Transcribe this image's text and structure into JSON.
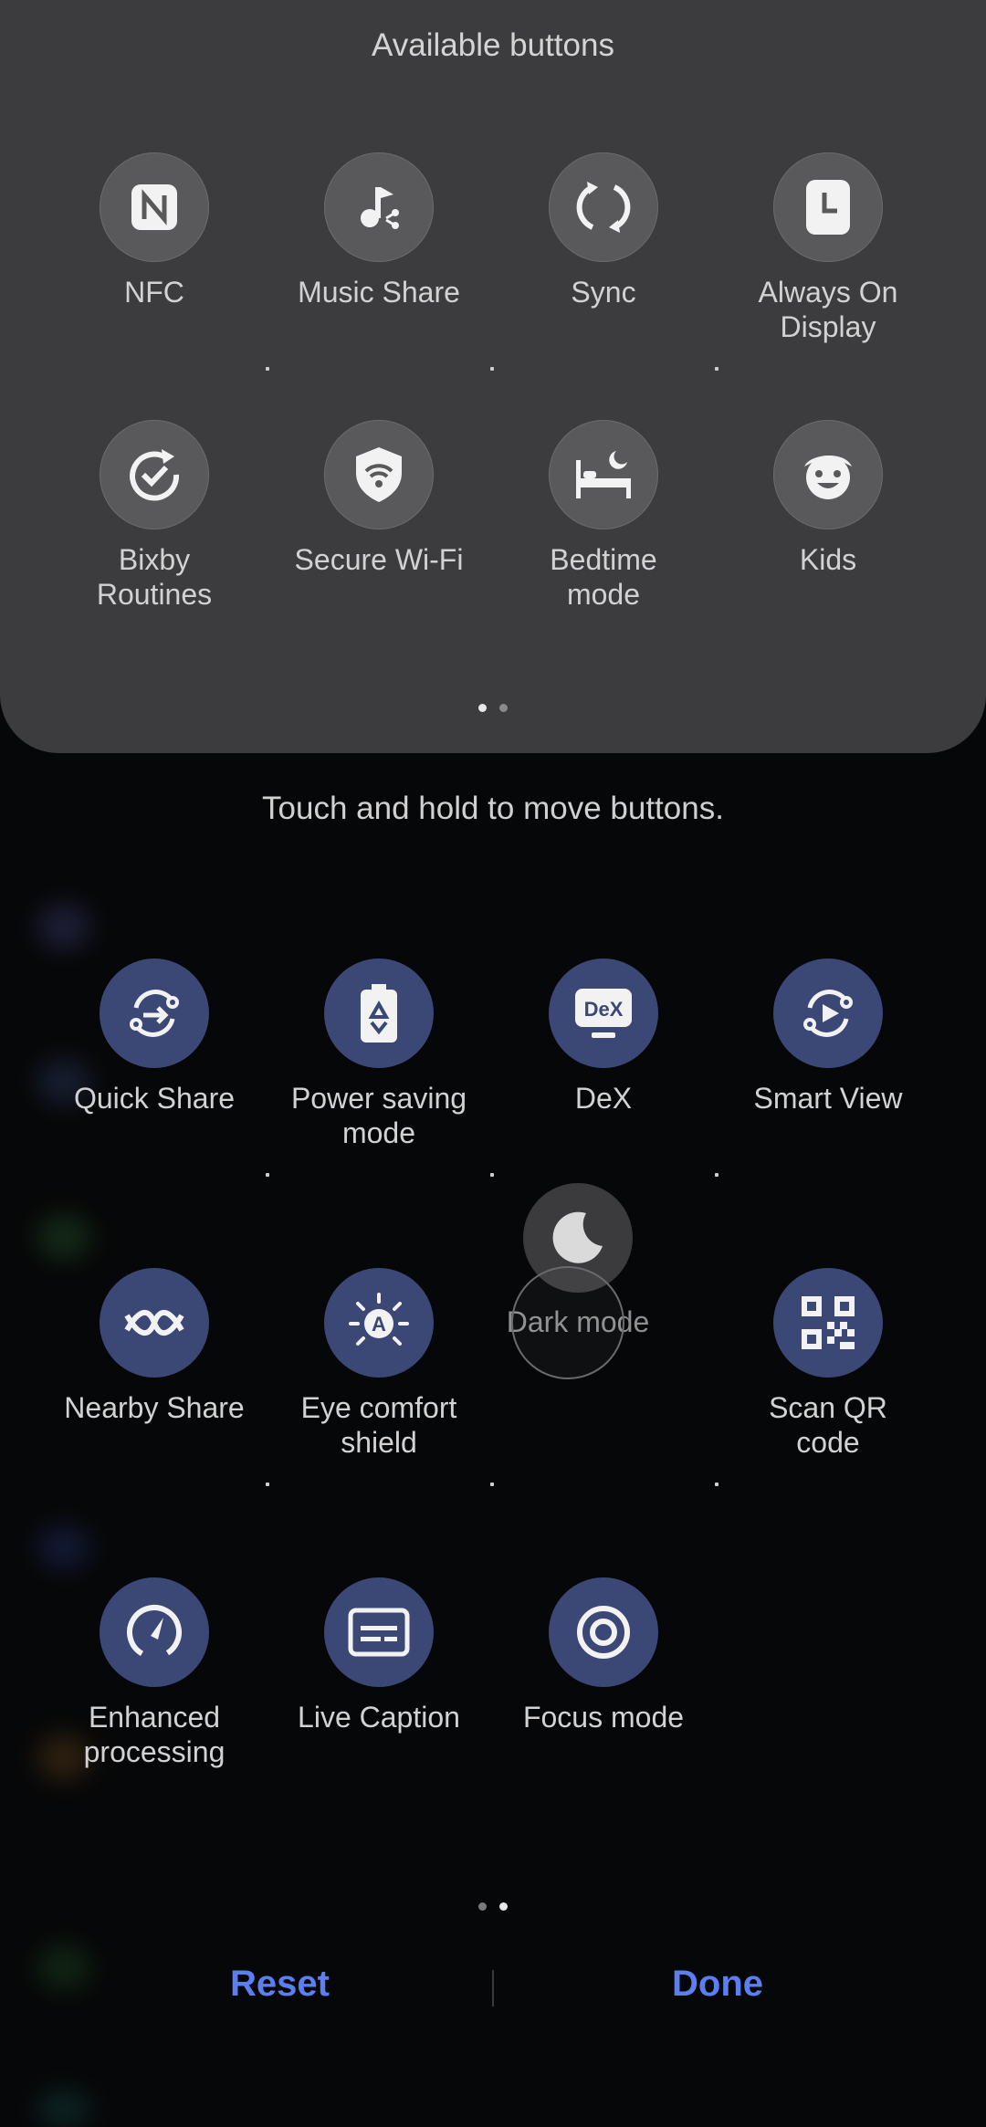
{
  "panel": {
    "title": "Available buttons",
    "buttons": [
      {
        "label": "NFC",
        "icon": "nfc-icon"
      },
      {
        "label": "Music Share",
        "icon": "music-share-icon"
      },
      {
        "label": "Sync",
        "icon": "sync-icon"
      },
      {
        "label": "Always On\nDisplay",
        "icon": "clock-icon"
      },
      {
        "label": "Bixby\nRoutines",
        "icon": "bixby-routines-icon"
      },
      {
        "label": "Secure Wi-Fi",
        "icon": "secure-wifi-icon"
      },
      {
        "label": "Bedtime\nmode",
        "icon": "bed-icon"
      },
      {
        "label": "Kids",
        "icon": "kids-icon"
      }
    ],
    "page_indicator": {
      "pages": 2,
      "current": 1
    }
  },
  "hint": "Touch and hold to move buttons.",
  "active": {
    "buttons": [
      {
        "label": "Quick Share",
        "icon": "quick-share-icon"
      },
      {
        "label": "Power saving\nmode",
        "icon": "battery-icon"
      },
      {
        "label": "DeX",
        "icon": "dex-icon"
      },
      {
        "label": "Smart View",
        "icon": "smart-view-icon"
      },
      {
        "label": "Nearby Share",
        "icon": "nearby-share-icon"
      },
      {
        "label": "Eye comfort\nshield",
        "icon": "eye-comfort-icon"
      },
      {
        "label": "Scan QR\ncode",
        "icon": "qr-code-icon"
      },
      {
        "label": "Enhanced\nprocessing",
        "icon": "gauge-icon"
      },
      {
        "label": "Live Caption",
        "icon": "caption-icon"
      },
      {
        "label": "Focus mode",
        "icon": "focus-icon"
      }
    ],
    "dragging": {
      "label": "Dark mode",
      "icon": "moon-icon"
    },
    "page_indicator": {
      "pages": 2,
      "current": 2
    }
  },
  "footer": {
    "reset_label": "Reset",
    "done_label": "Done"
  },
  "colors": {
    "accent": "#5b7ff0",
    "active_tile": "#3b4876",
    "panel": "#3c3c3e"
  }
}
